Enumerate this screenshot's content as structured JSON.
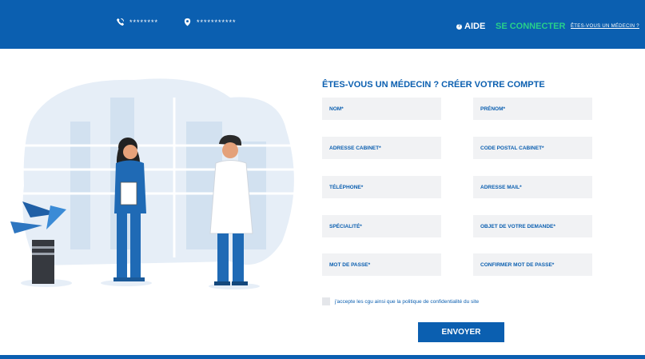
{
  "header": {
    "phone_value": "********",
    "location_value": "***********",
    "help_label": "AIDE",
    "login_label": "SE CONNECTER",
    "doctor_link": "ÊTES-VOUS UN MÉDECIN ?"
  },
  "form": {
    "title": "ÊTES-VOUS UN MÉDECIN ? CRÉER VOTRE COMPTE",
    "fields": {
      "nom": "NOM*",
      "prenom": "PRÉNOM*",
      "adresse_cabinet": "ADRESSE CABINET*",
      "code_postal": "CODE POSTAL CABINET*",
      "telephone": "TÉLÉPHONE*",
      "email": "ADRESSE MAIL*",
      "specialite": "SPÉCIALITÉ*",
      "objet": "OBJET DE VOTRE DEMANDE*",
      "mot_de_passe": "MOT DE PASSE*",
      "confirm_mdp": "CONFIRMER MOT DE PASSE*"
    },
    "cgu_text": "j'accepte les cgu ainsi que la politique de confidentialité du site",
    "submit_label": "ENVOYER"
  },
  "colors": {
    "primary": "#0b5fb0",
    "accent": "#27d08a",
    "field_bg": "#f1f2f4"
  }
}
